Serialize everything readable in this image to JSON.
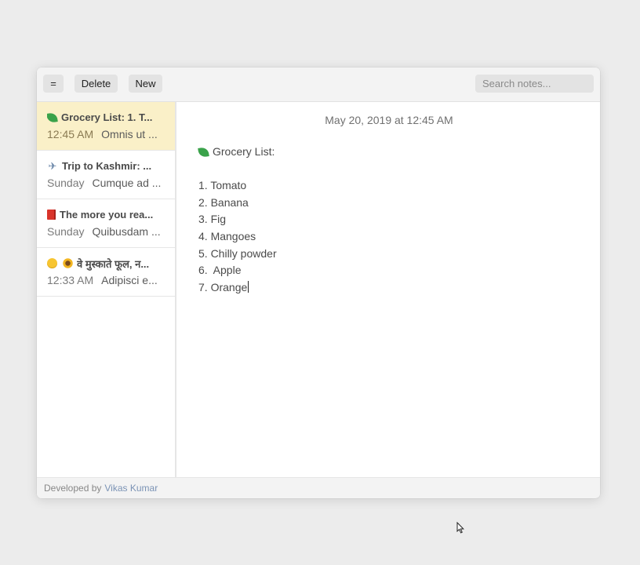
{
  "toolbar": {
    "menu_label": "=",
    "delete_label": "Delete",
    "new_label": "New",
    "search_placeholder": "Search notes..."
  },
  "notes": [
    {
      "icons": [
        "leaf-icon"
      ],
      "title": "Grocery List: 1. T...",
      "time": "12:45 AM",
      "preview": "Omnis ut ...",
      "active": true
    },
    {
      "icons": [
        "plane-icon"
      ],
      "title": "Trip to Kashmir: ...",
      "time": "Sunday",
      "preview": "Cumque ad ...",
      "active": false
    },
    {
      "icons": [
        "book-icon"
      ],
      "title": "The more you rea...",
      "time": "Sunday",
      "preview": "Quibusdam ...",
      "active": false
    },
    {
      "icons": [
        "smile-icon",
        "sunflower-icon"
      ],
      "title": "वे मुस्काते फूल, न...",
      "time": "12:33 AM",
      "preview": "Adipisci e...",
      "active": false
    }
  ],
  "editor": {
    "date": "May 20, 2019 at 12:45 AM",
    "heading_icon": "leaf-icon",
    "heading": "Grocery List:",
    "lines": [
      "1. Tomato",
      "2. Banana",
      "3. Fig",
      "4. Mangoes",
      "5. Chilly powder",
      "6.  Apple",
      "7. Orange"
    ]
  },
  "footer": {
    "prefix": "Developed by",
    "author": "Vikas Kumar"
  },
  "colors": {
    "active_note_bg": "#faf0c8",
    "link": "#7b93b5"
  }
}
